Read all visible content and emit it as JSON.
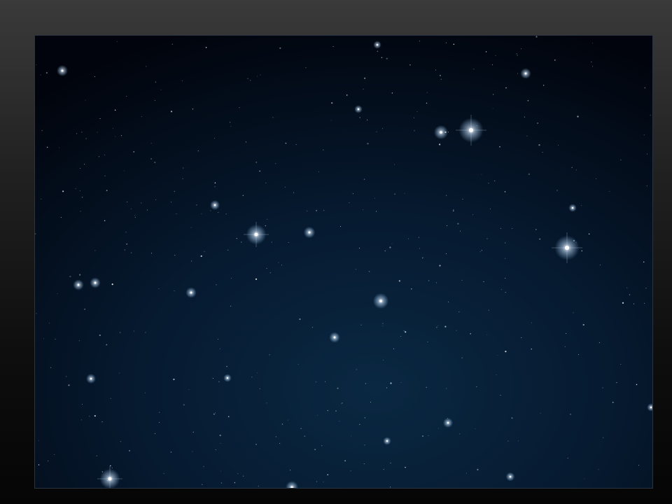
{
  "viewer": {
    "photo": {
      "subject": "night-sky-starfield-photo",
      "colors": {
        "sky_deep": "#01040c",
        "sky_mid": "#061a30",
        "sky_glow": "#0a2842",
        "star": "#ffffff",
        "star_tint": "#cfe6ff"
      }
    }
  }
}
